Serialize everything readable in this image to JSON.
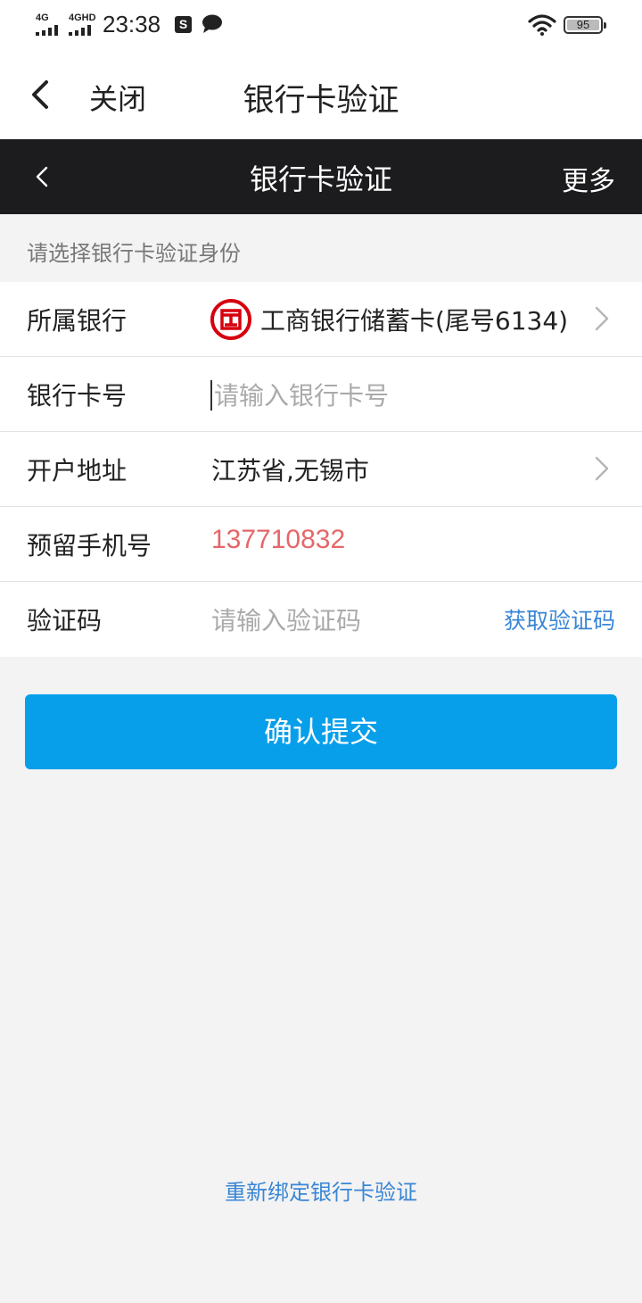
{
  "status_bar": {
    "network_1": "4G",
    "network_2": "4GHD",
    "time": "23:38",
    "s_icon": "S",
    "battery": "95",
    "icons": [
      "signal-icon",
      "s-app-icon",
      "chat-icon",
      "wifi-icon",
      "battery-icon"
    ]
  },
  "app_nav": {
    "close_label": "关闭",
    "title": "银行卡验证"
  },
  "web_header": {
    "title": "银行卡验证",
    "more_label": "更多"
  },
  "hint": "请选择银行卡验证身份",
  "form": {
    "bank": {
      "label": "所属银行",
      "value": "工商银行储蓄卡(尾号6134)",
      "logo_char": "工"
    },
    "card_number": {
      "label": "银行卡号",
      "placeholder": "请输入银行卡号"
    },
    "address": {
      "label": "开户地址",
      "value": "江苏省,无锡市"
    },
    "phone": {
      "label": "预留手机号",
      "value": "137710832"
    },
    "code": {
      "label": "验证码",
      "placeholder": "请输入验证码",
      "get_code_label": "获取验证码"
    }
  },
  "submit_label": "确认提交",
  "rebind_label": "重新绑定银行卡验证",
  "colors": {
    "accent": "#089fea",
    "link": "#3a86d6",
    "phone": "#e5676a",
    "header_bg": "#1c1c1e",
    "bank_red": "#d7000f"
  }
}
